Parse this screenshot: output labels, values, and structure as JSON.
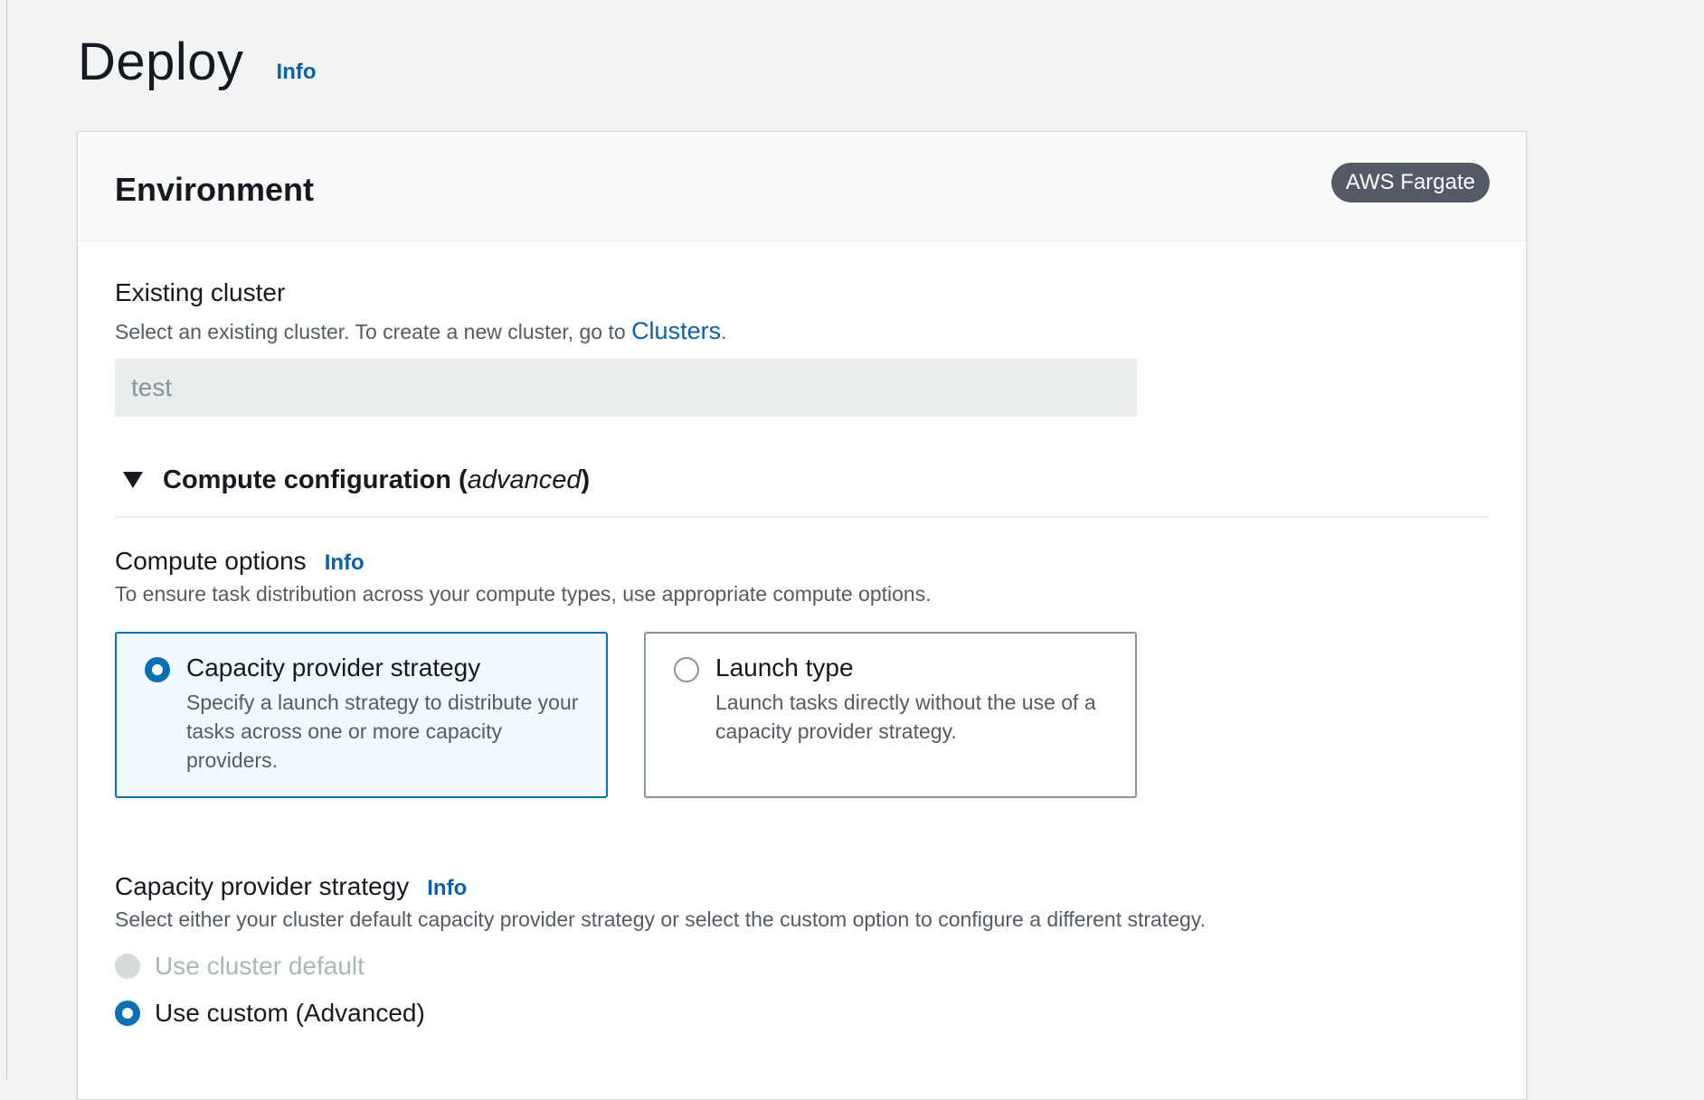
{
  "page": {
    "title": "Deploy",
    "info_label": "Info"
  },
  "environment": {
    "title": "Environment",
    "badge": "AWS Fargate",
    "existing_cluster": {
      "label": "Existing cluster",
      "description_prefix": "Select an existing cluster. To create a new cluster, go to ",
      "description_link": "Clusters",
      "description_suffix": ".",
      "value": "test"
    },
    "compute_configuration": {
      "label": "Compute configuration (",
      "label_italic": "advanced",
      "label_suffix": ")",
      "expanded": true
    },
    "compute_options": {
      "label": "Compute options",
      "info_label": "Info",
      "description": "To ensure task distribution across your compute types, use appropriate compute options.",
      "tiles": [
        {
          "title": "Capacity provider strategy",
          "description": "Specify a launch strategy to distribute your tasks across one or more capacity providers.",
          "selected": true
        },
        {
          "title": "Launch type",
          "description": "Launch tasks directly without the use of a capacity provider strategy.",
          "selected": false
        }
      ]
    },
    "capacity_provider_strategy": {
      "label": "Capacity provider strategy",
      "info_label": "Info",
      "description": "Select either your cluster default capacity provider strategy or select the custom option to configure a different strategy.",
      "options": [
        {
          "label": "Use cluster default",
          "disabled": true,
          "checked": false
        },
        {
          "label": "Use custom (Advanced)",
          "disabled": false,
          "checked": true
        }
      ]
    }
  },
  "colors": {
    "accent": "#0a6fb3",
    "link": "#0a61a8",
    "badge": "#545b64"
  }
}
